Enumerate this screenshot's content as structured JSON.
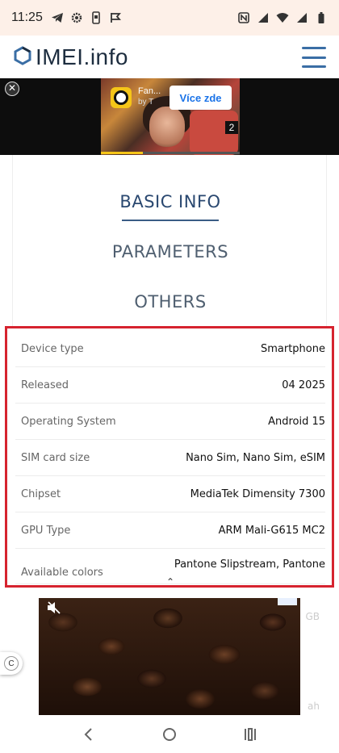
{
  "status_bar": {
    "time": "11:25",
    "icons_left": [
      "telegram-icon",
      "settings-icon",
      "phone-icon",
      "flag-icon"
    ],
    "icons_right": [
      "nfc-icon",
      "signal-icon",
      "wifi-icon",
      "cell-icon",
      "battery-icon"
    ]
  },
  "header": {
    "logo_text": "IMEI.info",
    "menu_icon": "hamburger-menu-icon"
  },
  "top_ad": {
    "title": "Fan...",
    "subtitle": "by T",
    "cta_label": "Více zde",
    "counter": "2",
    "close_icon": "close-icon",
    "progress_fraction": 0.3
  },
  "tabs": [
    {
      "label": "BASIC INFO",
      "active": true
    },
    {
      "label": "PARAMETERS",
      "active": false
    },
    {
      "label": "OTHERS",
      "active": false
    }
  ],
  "specs": [
    {
      "label": "Device type",
      "value": "Smartphone"
    },
    {
      "label": "Released",
      "value": "04 2025"
    },
    {
      "label": "Operating System",
      "value": "Android 15"
    },
    {
      "label": "SIM card size",
      "value": "Nano Sim, Nano Sim, eSIM"
    },
    {
      "label": "Chipset",
      "value": "MediaTek Dimensity 7300"
    },
    {
      "label": "GPU Type",
      "value": "ARM Mali-G615 MC2"
    },
    {
      "label": "Available colors",
      "value": "Pantone Slipstream, Pantone"
    }
  ],
  "below": {
    "ghost_right_1": "GB",
    "ghost_right_2": "ah",
    "side_button_label": "C"
  },
  "colors": {
    "accent": "#3a6ea5",
    "highlight_border": "#d6232f",
    "status_bar_bg": "#fdf0e8"
  }
}
